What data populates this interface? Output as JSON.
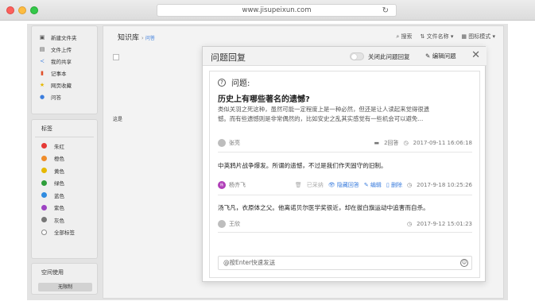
{
  "browser": {
    "url": "www.jisupeixun.com",
    "reload_icon": "reload-icon"
  },
  "sidebar": {
    "nav": [
      {
        "icon": "new-folder-icon",
        "label": "新建文件夹"
      },
      {
        "icon": "upload-icon",
        "label": "文件上传"
      },
      {
        "icon": "share-icon",
        "label": "我的共享"
      },
      {
        "icon": "notebook-icon",
        "label": "记事本"
      },
      {
        "icon": "star-icon",
        "label": "网页收藏"
      },
      {
        "icon": "question-icon",
        "label": "问答"
      }
    ],
    "tags_title": "标签",
    "tags": [
      {
        "label": "朱红",
        "color": "#e53935"
      },
      {
        "label": "橙色",
        "color": "#ef8c2a"
      },
      {
        "label": "黄色",
        "color": "#e6b800"
      },
      {
        "label": "绿色",
        "color": "#2e9e3a"
      },
      {
        "label": "蓝色",
        "color": "#2f8be0"
      },
      {
        "label": "紫色",
        "color": "#9c43c2"
      },
      {
        "label": "灰色",
        "color": "#777777"
      },
      {
        "label": "全部标签",
        "color": ""
      }
    ],
    "space_title": "空间使用",
    "space_button": "无限制"
  },
  "main": {
    "breadcrumb_root": "知识库",
    "breadcrumb_sub": "问答",
    "tools": {
      "search": "搜索",
      "sort": "文件名称",
      "view": "图标模式"
    },
    "side_text": "这是"
  },
  "modal": {
    "title": "问题回复",
    "toggle_label": "关闭此问题回复",
    "edit_label": "编辑问题",
    "question_label": "问题:",
    "question_title": "历史上有哪些著名的遗憾?",
    "question_body_1": "类似关羽之死这种，虽然可能一定程度上是一种必然，但还是让人读起来觉得很遗",
    "question_body_2": "憾。而有些遗憾则是非常偶然的，比如安史之乱其实感觉有一些机会可以避免...",
    "asker": "张亮",
    "answer_count": "2回答",
    "asked_time": "2017-09-11 16:06:18",
    "answer_1": "中英鸦片战争爆发。所谓的遗憾，不过是我们作天固守的旧制。",
    "answerer_1": "杨齐飞",
    "accepted_label": "已采纳",
    "hide_label": "隐藏回答",
    "edit_answer_label": "编辑",
    "delete_label": "删除",
    "answer_1_time": "2017-9-18 10:25:26",
    "answer_2": "汤飞凡，衣原体之父。他离诺贝尔医学奖很近，却在拔白旗运动中追害而自杀。",
    "answerer_2": "王欣",
    "answer_2_time": "2017-9-12 15:01:23",
    "input_placeholder": "@按Enter快速发送"
  }
}
